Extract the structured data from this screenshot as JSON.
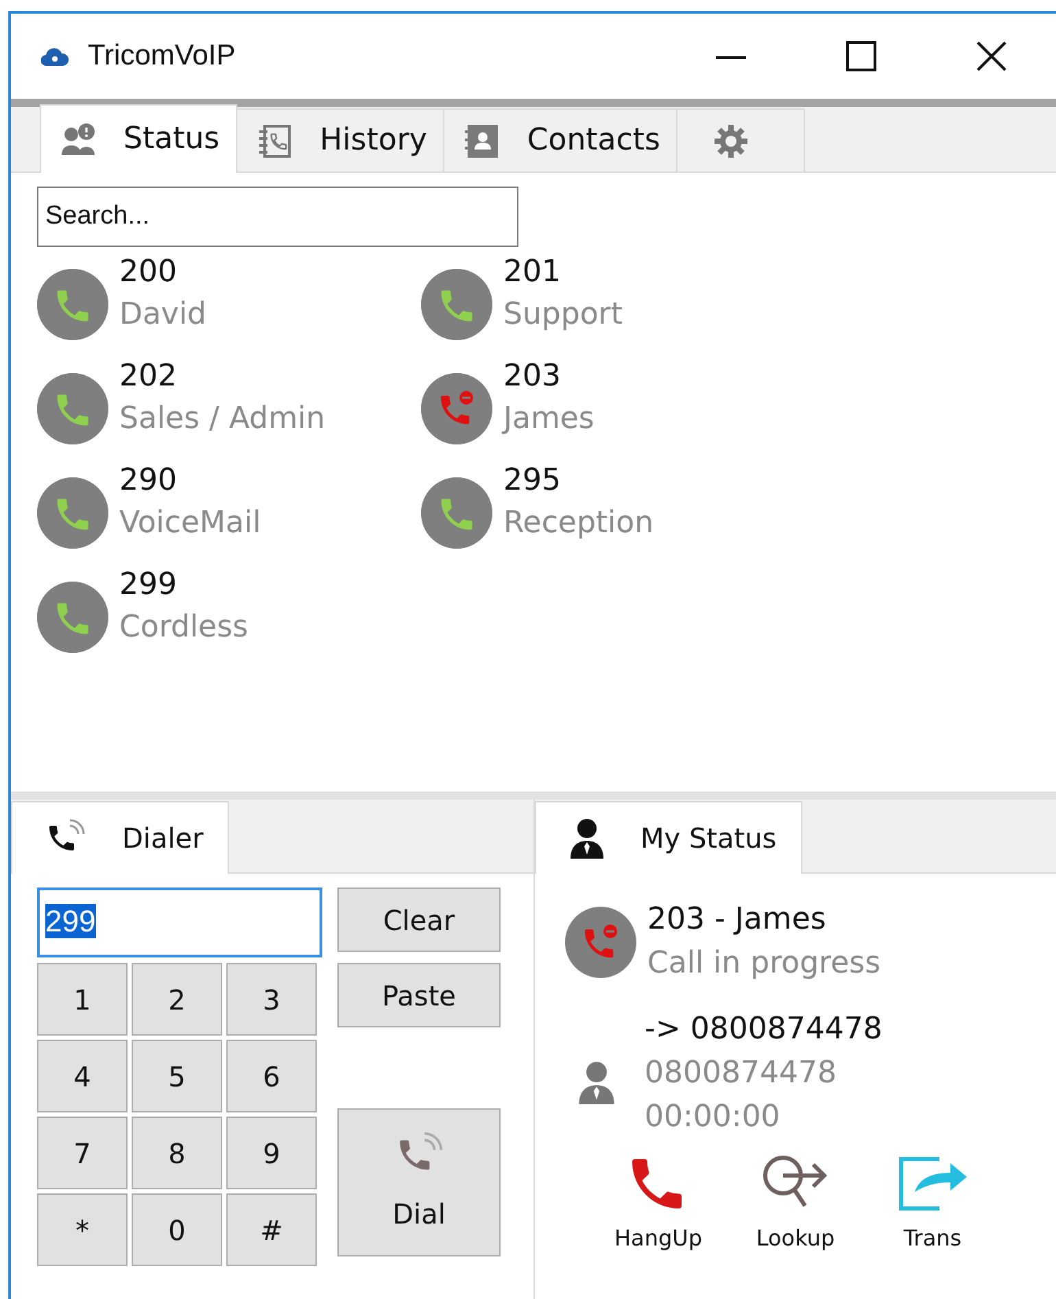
{
  "window": {
    "title": "TricomVoIP"
  },
  "tabs": [
    {
      "kind": "status",
      "label": "Status",
      "selected": true
    },
    {
      "kind": "history",
      "label": "History",
      "selected": false
    },
    {
      "kind": "contacts",
      "label": "Contacts",
      "selected": false
    },
    {
      "kind": "settings",
      "selected": false
    }
  ],
  "search": {
    "placeholder": "Search..."
  },
  "extensions": [
    {
      "number": "200",
      "name": "David",
      "busy": false
    },
    {
      "number": "201",
      "name": "Support",
      "busy": false
    },
    {
      "number": "202",
      "name": "Sales / Admin",
      "busy": false
    },
    {
      "number": "203",
      "name": "James",
      "busy": true
    },
    {
      "number": "290",
      "name": "VoiceMail",
      "busy": false
    },
    {
      "number": "295",
      "name": "Reception",
      "busy": false
    },
    {
      "number": "299",
      "name": "Cordless",
      "busy": false
    }
  ],
  "dialer": {
    "tab": {
      "label": "Dialer",
      "selected": true
    },
    "value": "299",
    "value_selected": true,
    "keys": [
      "1",
      "2",
      "3",
      "4",
      "5",
      "6",
      "7",
      "8",
      "9",
      "*",
      "0",
      "#"
    ],
    "buttons": [
      "Clear",
      "Paste"
    ],
    "dial_button": "Dial"
  },
  "my_status": {
    "tab": {
      "label": "My Status",
      "selected": true
    },
    "extension": "203 - James",
    "busy": true,
    "state": "Call in progress",
    "call_to": "-> 0800874478",
    "caller": "0800874478",
    "duration": "00:00:00",
    "actions": [
      {
        "kind": "hangup",
        "label": "HangUp"
      },
      {
        "kind": "lookup",
        "label": "Lookup"
      },
      {
        "kind": "transfer",
        "label": "Trans"
      }
    ]
  }
}
